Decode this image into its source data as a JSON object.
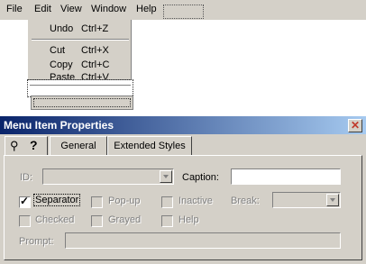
{
  "menubar": {
    "items": [
      "File",
      "Edit",
      "View",
      "Window",
      "Help"
    ]
  },
  "edit_menu": {
    "items": [
      {
        "label": "Undo",
        "accel": "Ctrl+Z"
      },
      {
        "label": "Cut",
        "accel": "Ctrl+X"
      },
      {
        "label": "Copy",
        "accel": "Ctrl+C"
      },
      {
        "label": "Paste",
        "accel": "Ctrl+V"
      }
    ]
  },
  "dialog": {
    "title": "Menu Item Properties",
    "tabs": [
      "General",
      "Extended Styles"
    ],
    "id_label": "ID:",
    "caption_label": "Caption:",
    "caption_value": "",
    "checkboxes": {
      "separator": {
        "label": "Separator",
        "checked": true
      },
      "popup": {
        "label": "Pop-up",
        "checked": false
      },
      "inactive": {
        "label": "Inactive",
        "checked": false
      },
      "checked": {
        "label": "Checked",
        "checked": false
      },
      "grayed": {
        "label": "Grayed",
        "checked": false
      },
      "help": {
        "label": "Help",
        "checked": false
      }
    },
    "break_label": "Break:",
    "prompt_label": "Prompt:",
    "colors": {
      "title_start": "#0a246a",
      "title_end": "#a6caf0",
      "face": "#d4d0c8",
      "close": "#c0392b"
    }
  }
}
